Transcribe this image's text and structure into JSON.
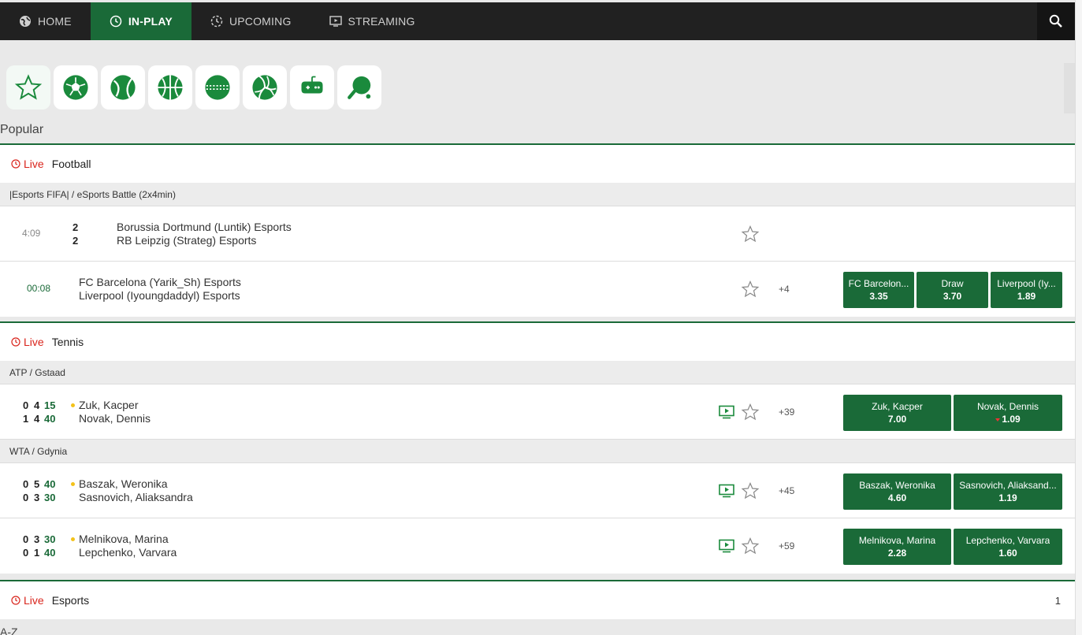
{
  "nav": {
    "items": [
      {
        "label": "HOME",
        "icon": "globe-icon",
        "active": false
      },
      {
        "label": "IN-PLAY",
        "icon": "clock-icon",
        "active": true
      },
      {
        "label": "UPCOMING",
        "icon": "upcoming-icon",
        "active": false
      },
      {
        "label": "STREAMING",
        "icon": "tv-icon",
        "active": false
      }
    ],
    "search_icon": "search-icon"
  },
  "sports_filter": [
    "star-icon",
    "football-icon",
    "tennis-icon",
    "basketball-icon",
    "cricket-icon",
    "volleyball-icon",
    "gamepad-icon",
    "table-tennis-icon"
  ],
  "popular_label": "Popular",
  "az_label": "A-Z",
  "live_label": "Live",
  "football": {
    "sport": "Football",
    "league": "|Esports FIFA| / eSports Battle (2x4min)",
    "events": [
      {
        "time": "4:09",
        "score": [
          "2",
          "2"
        ],
        "home": "Borussia Dortmund (Luntik) Esports",
        "away": "RB Leipzig (Strateg) Esports"
      },
      {
        "time": "00:08",
        "home": "FC Barcelona (Yarik_Sh) Esports",
        "away": "Liverpool (Iyoungdaddyl) Esports",
        "more": "+4",
        "odds": [
          {
            "label": "FC Barcelon...",
            "price": "3.35"
          },
          {
            "label": "Draw",
            "price": "3.70"
          },
          {
            "label": "Liverpool (Iy...",
            "price": "1.89"
          }
        ]
      }
    ]
  },
  "tennis": {
    "sport": "Tennis",
    "leagues": [
      {
        "name": "ATP / Gstaad",
        "events": [
          {
            "p1": {
              "sets": "0",
              "games": "4",
              "points": "15",
              "name": "Zuk, Kacper"
            },
            "p2": {
              "sets": "1",
              "games": "4",
              "points": "40",
              "name": "Novak, Dennis"
            },
            "more": "+39",
            "odds": [
              {
                "label": "Zuk, Kacper",
                "price": "7.00"
              },
              {
                "label": "Novak, Dennis",
                "price": "1.09"
              }
            ]
          }
        ]
      },
      {
        "name": "WTA / Gdynia",
        "events": [
          {
            "p1": {
              "sets": "0",
              "games": "5",
              "points": "40",
              "name": "Baszak, Weronika"
            },
            "p2": {
              "sets": "0",
              "games": "3",
              "points": "30",
              "name": "Sasnovich, Aliaksandra"
            },
            "more": "+45",
            "odds": [
              {
                "label": "Baszak, Weronika",
                "price": "4.60"
              },
              {
                "label": "Sasnovich, Aliaksand...",
                "price": "1.19"
              }
            ]
          },
          {
            "p1": {
              "sets": "0",
              "games": "3",
              "points": "30",
              "name": "Melnikova, Marina"
            },
            "p2": {
              "sets": "0",
              "games": "1",
              "points": "40",
              "name": "Lepchenko, Varvara"
            },
            "more": "+59",
            "odds": [
              {
                "label": "Melnikova, Marina",
                "price": "2.28"
              },
              {
                "label": "Lepchenko, Varvara",
                "price": "1.60"
              }
            ]
          }
        ]
      }
    ]
  },
  "esports": {
    "sport": "Esports",
    "count": "1"
  },
  "colors": {
    "brand_green": "#1a6a38",
    "live_red": "#d9251d",
    "nav_bg": "#212121",
    "serve_dot": "#f3c21a"
  }
}
